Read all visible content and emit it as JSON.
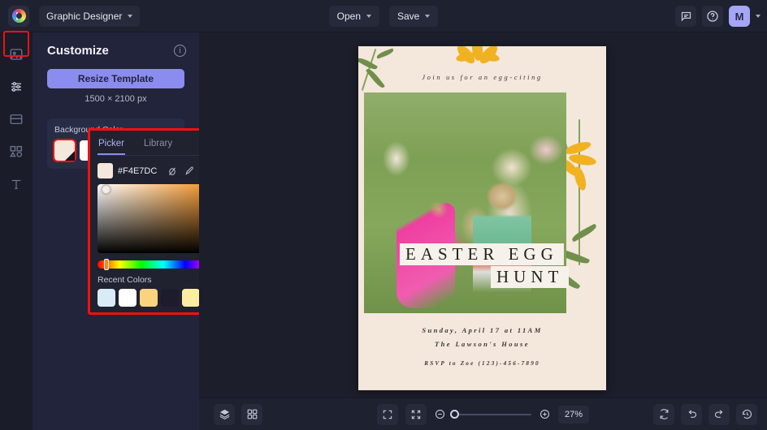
{
  "topbar": {
    "logo_name": "app-logo",
    "project_title": "Graphic Designer",
    "open_label": "Open",
    "save_label": "Save",
    "comment_icon": "comment-icon",
    "help_icon": "help-icon",
    "avatar_initial": "M"
  },
  "rail": {
    "items": [
      {
        "name": "images",
        "icon": "image-icon"
      },
      {
        "name": "customize",
        "icon": "sliders-icon"
      },
      {
        "name": "layouts",
        "icon": "layout-icon"
      },
      {
        "name": "shapes",
        "icon": "shapes-icon"
      },
      {
        "name": "text",
        "icon": "text-icon"
      }
    ]
  },
  "panel": {
    "title": "Customize",
    "info_icon": "info-icon",
    "resize_label": "Resize Template",
    "dimensions": "1500 × 2100 px",
    "background_color_label": "Background Color",
    "swatches": [
      {
        "hex": "#F4E7DC",
        "selected": true
      },
      {
        "hex": "#FFFFFF",
        "selected": false
      },
      {
        "hex": "#C2173C",
        "selected": false
      },
      {
        "hex": "#D59B16",
        "selected": false
      }
    ]
  },
  "picker": {
    "tabs": [
      {
        "label": "Picker",
        "active": true
      },
      {
        "label": "Library",
        "active": false
      }
    ],
    "hex_value": "#F4E7DC",
    "tools": [
      {
        "name": "no-color-icon"
      },
      {
        "name": "eyedropper-icon"
      },
      {
        "name": "palette-grid-icon"
      },
      {
        "name": "add-color-icon"
      }
    ],
    "recent_label": "Recent Colors",
    "recent_colors": [
      "#D8EBF6",
      "#FFFFFF",
      "#F9D37E",
      "#1E1B2E",
      "#FAEFA0",
      "#000000"
    ]
  },
  "canvas": {
    "background_hex": "#F4E7DC",
    "kicker": "Join us for an egg-citing",
    "title_line_1": "EASTER EGG",
    "title_line_2": "HUNT",
    "footer_line_1": "Sunday, April 17 at 11AM",
    "footer_line_2": "The Lawson's House",
    "footer_rsvp": "RSVP to Zoe (123)-456-7890"
  },
  "bottombar": {
    "layers_icon": "layers-icon",
    "grid_icon": "grid-icon",
    "fullscreen_icon": "fullscreen-icon",
    "fit_icon": "fit-to-screen-icon",
    "zoom_out_icon": "zoom-out-icon",
    "zoom_in_icon": "zoom-in-icon",
    "zoom_percent": "27%",
    "reset_icon": "reset-icon",
    "undo_icon": "undo-icon",
    "redo_icon": "redo-icon",
    "history_icon": "history-icon"
  },
  "colors": {
    "accent": "#8B8CF0",
    "highlight_box": "#F41010",
    "panel_bg": "#21243A",
    "topbar_bg": "#1E2130"
  }
}
